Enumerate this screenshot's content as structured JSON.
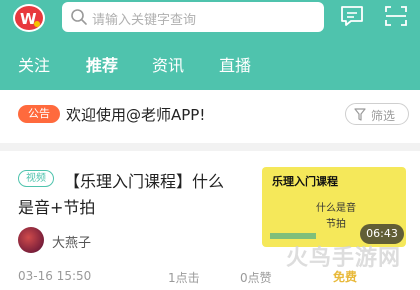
{
  "header": {
    "search_placeholder": "请输入关键字查询",
    "icons": [
      "app-logo",
      "search-icon",
      "message-icon",
      "scan-icon"
    ],
    "brand_color": "#4fc3ad"
  },
  "tabs": [
    {
      "label": "关注",
      "active": false
    },
    {
      "label": "推荐",
      "active": true
    },
    {
      "label": "资讯",
      "active": false
    },
    {
      "label": "直播",
      "active": false
    }
  ],
  "notice": {
    "badge": "公告",
    "text": "欢迎使用@老师APP!",
    "filter_label": "筛选",
    "badge_color": "#ff6a3d"
  },
  "article": {
    "type_badge": "视频",
    "title_line1": "【乐理入门课程】什么",
    "title_line2": "是音+节拍",
    "author": "大燕子",
    "date": "03-16 15:50",
    "clicks": "1点击",
    "likes": "0点赞",
    "price_tag": "免费",
    "thumbnail": {
      "title": "乐理入门课程",
      "line1": "什么是音",
      "line2": "节拍",
      "duration": "06:43",
      "background": "#f5e85a"
    }
  },
  "watermark": "火鸟手游网"
}
